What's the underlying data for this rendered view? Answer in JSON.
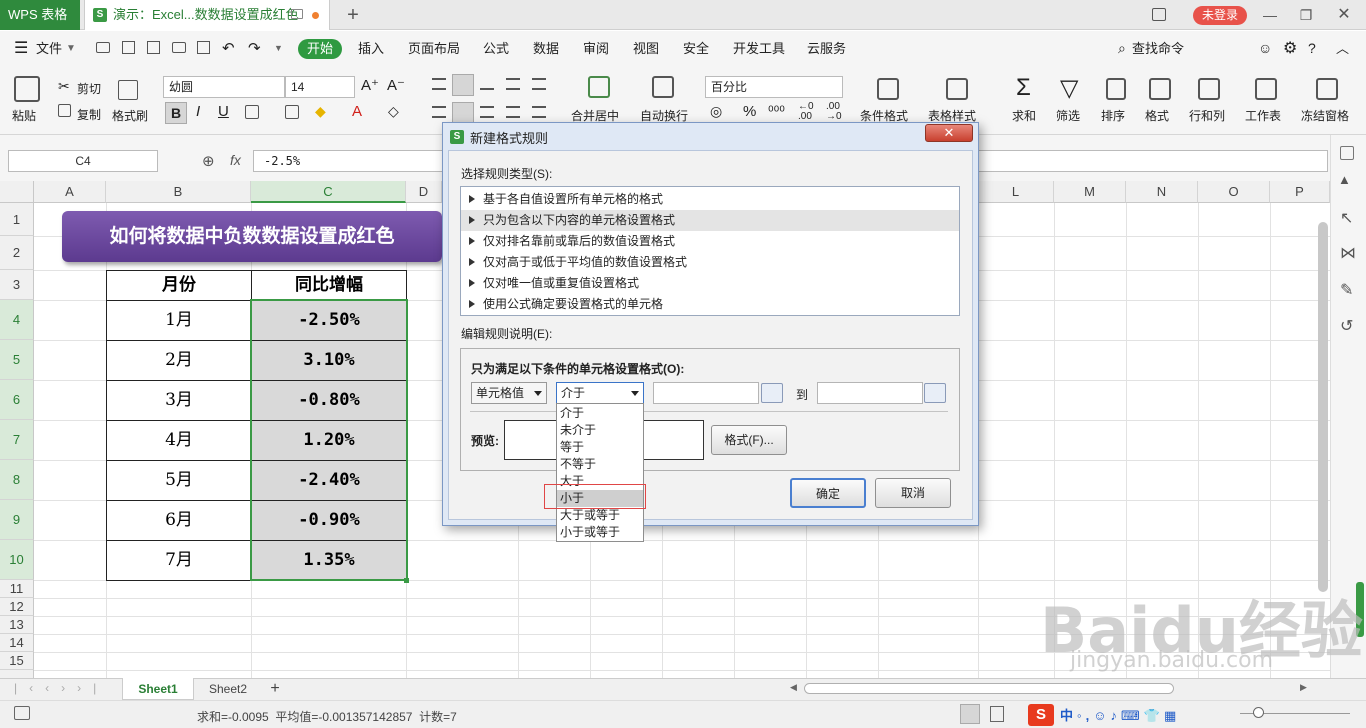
{
  "titlebar": {
    "app_name": "WPS 表格",
    "doc_tab": "演示：Excel...数数据设置成红色",
    "new_tab": "+",
    "login": "未登录"
  },
  "menu": {
    "file": "文件",
    "items": [
      "开始",
      "插入",
      "页面布局",
      "公式",
      "数据",
      "审阅",
      "视图",
      "安全",
      "开发工具",
      "云服务"
    ],
    "search": "查找命令"
  },
  "ribbon": {
    "paste": "粘贴",
    "cut": "剪切",
    "copy": "复制",
    "format_painter": "格式刷",
    "font_name": "幼圆",
    "font_size": "14",
    "merge_center": "合并居中",
    "auto_wrap": "自动换行",
    "number_format": "百分比",
    "cond_format": "条件格式",
    "table_style": "表格样式",
    "sum": "求和",
    "filter": "筛选",
    "sort": "排序",
    "format": "格式",
    "row_col": "行和列",
    "worksheet": "工作表",
    "freeze": "冻结窗格"
  },
  "formula_bar": {
    "name_box": "C4",
    "fx": "fx",
    "value": "-2.5%"
  },
  "columns": [
    "A",
    "B",
    "C",
    "D",
    "L",
    "M",
    "N",
    "O",
    "P"
  ],
  "rows": [
    "1",
    "2",
    "3",
    "4",
    "5",
    "6",
    "7",
    "8",
    "9",
    "10",
    "11",
    "12",
    "13",
    "14",
    "15"
  ],
  "banner": "如何将数据中负数数据设置成红色",
  "table": {
    "headers": [
      "月份",
      "同比增幅"
    ],
    "rows": [
      {
        "month": "1月",
        "value": "-2.50%"
      },
      {
        "month": "2月",
        "value": "3.10%"
      },
      {
        "month": "3月",
        "value": "-0.80%"
      },
      {
        "month": "4月",
        "value": "1.20%"
      },
      {
        "month": "5月",
        "value": "-2.40%"
      },
      {
        "month": "6月",
        "value": "-0.90%"
      },
      {
        "month": "7月",
        "value": "1.35%"
      }
    ]
  },
  "dialog": {
    "title": "新建格式规则",
    "close": "✕",
    "select_rule_type": "选择规则类型(S):",
    "rule_types": [
      "基于各自值设置所有单元格的格式",
      "只为包含以下内容的单元格设置格式",
      "仅对排名靠前或靠后的数值设置格式",
      "仅对高于或低于平均值的数值设置格式",
      "仅对唯一值或重复值设置格式",
      "使用公式确定要设置格式的单元格"
    ],
    "edit_rule_desc": "编辑规则说明(E):",
    "condition_heading": "只为满足以下条件的单元格设置格式(O):",
    "cell_value": "单元格值",
    "operator": "介于",
    "to": "到",
    "preview": "预览:",
    "format_btn": "格式(F)...",
    "ok": "确定",
    "cancel": "取消",
    "operator_options": [
      "介于",
      "未介于",
      "等于",
      "不等于",
      "大于",
      "小于",
      "大于或等于",
      "小于或等于"
    ]
  },
  "sheets": {
    "tabs": [
      "Sheet1",
      "Sheet2"
    ],
    "add": "+"
  },
  "status": {
    "text": "求和=-0.0095  平均值=-0.001357142857  计数=7"
  },
  "watermark": {
    "main": "Baidu经验",
    "sub": "jingyan.baidu.com"
  }
}
